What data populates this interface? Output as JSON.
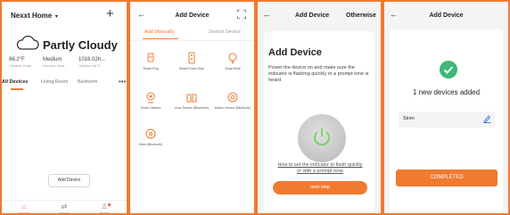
{
  "screen1": {
    "home_title": "Nexxt Home",
    "weather": "Partly Cloudy",
    "stats": [
      {
        "value": "86.2°F",
        "label": "Outdoor Temp"
      },
      {
        "value": "Medium",
        "label": "Outdoor Hum..."
      },
      {
        "value": "1016.02h...",
        "label": "Outdoor Air P..."
      }
    ],
    "tabs": [
      "All Devices",
      "Living Room",
      "Bedroom"
    ],
    "add_device_button": "Add Device",
    "nav": [
      "Devices",
      "Actions",
      "Profile"
    ]
  },
  "screen2": {
    "title": "Add Device",
    "tabs": [
      "Add Manually",
      "Search Device"
    ],
    "devices": [
      {
        "label": "Smart Plug",
        "icon": "plug-icon"
      },
      {
        "label": "Smart Power Strip",
        "icon": "power-strip-icon"
      },
      {
        "label": "Smart Bulb",
        "icon": "bulb-icon"
      },
      {
        "label": "Smart Camera",
        "icon": "camera-icon"
      },
      {
        "label": "Door Sensor (Bluetooth)",
        "icon": "door-sensor-icon"
      },
      {
        "label": "Motion Sensor (Bluetooth)",
        "icon": "motion-sensor-icon"
      },
      {
        "label": "Siren (Bluetooth)",
        "icon": "siren-icon"
      }
    ]
  },
  "screen3": {
    "title": "Add Device",
    "other_link": "Otherwise",
    "card_title": "Add Device",
    "description": "Power the device on and make sure the indicator is flashing quickly or a prompt tone is heard",
    "help_link": "How to set the indicator to flash quickly or with a prompt tone",
    "next_button": "next step"
  },
  "screen4": {
    "title": "Add Device",
    "added_message": "1 new devices added",
    "device_name": "Siren",
    "complete_button": "COMPLETED"
  },
  "colors": {
    "accent": "#f07a30",
    "success": "#3cb878",
    "border": "#f07a30"
  }
}
